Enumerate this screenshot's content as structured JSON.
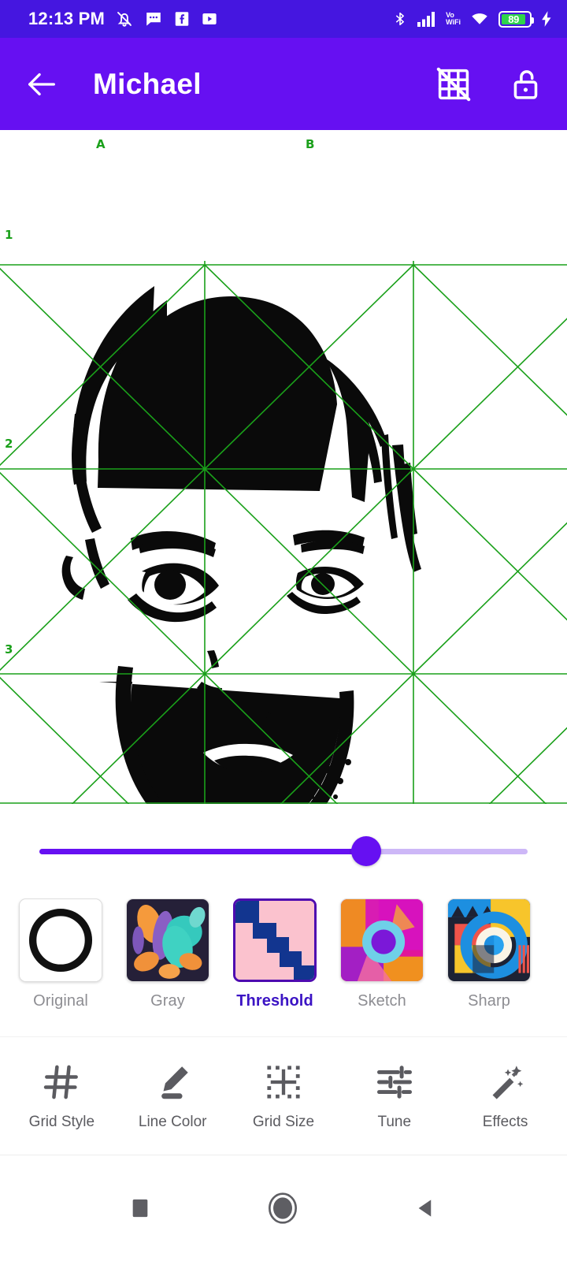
{
  "status_bar": {
    "time": "12:13 PM",
    "battery_percent": "89",
    "network_label_top": "Vo",
    "network_label_bottom": "WiFi",
    "icons": [
      "alarm-off-icon",
      "message-icon",
      "facebook-icon",
      "youtube-icon",
      "bluetooth-icon",
      "cellular-signal-icon",
      "vowifi-icon",
      "wifi-icon",
      "battery-icon",
      "charging-bolt-icon"
    ],
    "background_color": "#4516e0"
  },
  "app_bar": {
    "title": "Michael",
    "back_icon": "arrow-left-icon",
    "grid_off_icon": "grid-off-icon",
    "lock_icon": "lock-open-icon",
    "background_color": "#6610f2"
  },
  "canvas": {
    "grid_color": "#1aa01a",
    "column_labels": [
      "A",
      "B"
    ],
    "row_labels": [
      "1",
      "2",
      "3"
    ],
    "image_description": "high-contrast black and white threshold portrait of a bearded man"
  },
  "slider": {
    "value_percent": 67,
    "active_color": "#6610f2",
    "track_color": "#cdb7f7"
  },
  "filters": {
    "selected": "Threshold",
    "items": [
      {
        "label": "Original",
        "thumb": "circle-outline-thumb"
      },
      {
        "label": "Gray",
        "thumb": "fluid-abstract-thumb"
      },
      {
        "label": "Threshold",
        "thumb": "pink-navy-stairs-thumb"
      },
      {
        "label": "Sketch",
        "thumb": "magenta-ring-thumb"
      },
      {
        "label": "Sharp",
        "thumb": "bauhaus-circles-thumb"
      }
    ]
  },
  "toolbar": {
    "items": [
      {
        "label": "Grid Style",
        "icon": "hash-grid-icon"
      },
      {
        "label": "Line Color",
        "icon": "pencil-icon"
      },
      {
        "label": "Grid Size",
        "icon": "dotted-grid-icon"
      },
      {
        "label": "Tune",
        "icon": "sliders-icon"
      },
      {
        "label": "Effects",
        "icon": "magic-wand-icon"
      }
    ]
  },
  "nav_bar": {
    "recents_icon": "square-icon",
    "home_icon": "circle-icon",
    "back_icon": "triangle-back-icon"
  }
}
